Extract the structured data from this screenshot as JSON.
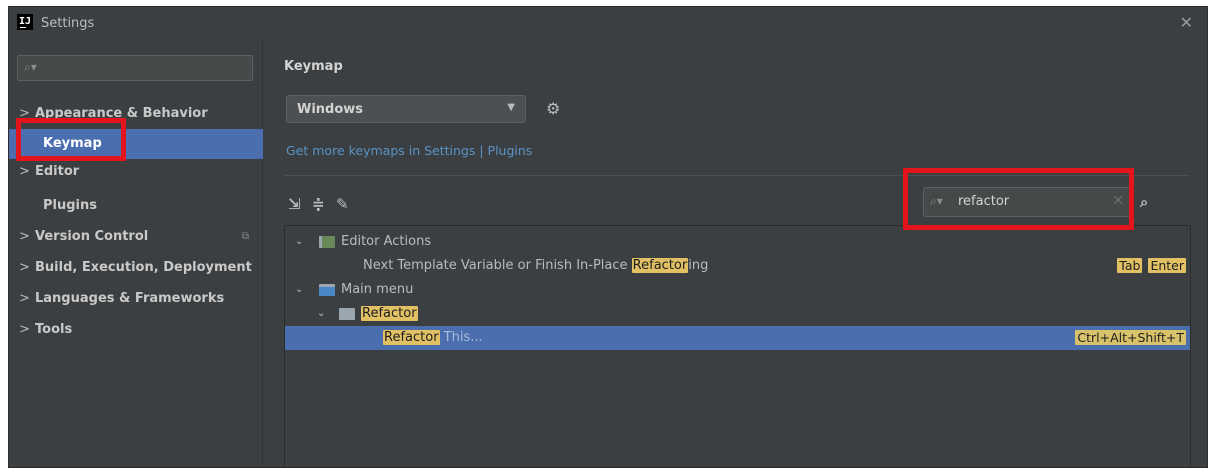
{
  "window": {
    "title": "Settings",
    "app_icon": "IJ",
    "close_glyph": "✕"
  },
  "sidebar": {
    "search": {
      "placeholder": "",
      "icon": "search-icon",
      "value": ""
    },
    "items": [
      {
        "label": "Appearance & Behavior",
        "chevron": ">"
      },
      {
        "label": "Keymap",
        "chevron": ""
      },
      {
        "label": "Editor",
        "chevron": ">"
      },
      {
        "label": "Plugins",
        "chevron": ""
      },
      {
        "label": "Version Control",
        "chevron": ">"
      },
      {
        "label": "Build, Execution, Deployment",
        "chevron": ">"
      },
      {
        "label": "Languages & Frameworks",
        "chevron": ">"
      },
      {
        "label": "Tools",
        "chevron": ">"
      }
    ]
  },
  "main": {
    "title": "Keymap",
    "keymap_select": {
      "value": "Windows",
      "arrow": "▼"
    },
    "gear_glyph": "⚙",
    "plugins_link": "Get more keymaps in Settings | Plugins",
    "toolbar": {
      "expand_glyph": "⇲",
      "collapse_glyph": "≑",
      "edit_glyph": "✎"
    },
    "filter": {
      "value": "refactor",
      "icon": "search-icon",
      "clear": "✕"
    },
    "find_shortcut_glyph": "⌕"
  },
  "tree": {
    "rows": [
      {
        "chevron": "⌄",
        "label": "Editor Actions"
      },
      {
        "pre": "Next Template Variable or Finish In-Place ",
        "match": "Refactor",
        "post": "ing",
        "keys": [
          "Tab",
          "Enter"
        ]
      },
      {
        "chevron": "⌄",
        "label": "Main menu"
      },
      {
        "chevron": "⌄",
        "match": "Refactor"
      },
      {
        "match": "Refactor",
        "post": " This...",
        "keys": [
          "Ctrl+Alt+Shift+T"
        ]
      }
    ]
  },
  "colors": {
    "background": "#3c3f41",
    "selection": "#4b6eaf",
    "highlight": "#e2c064",
    "link": "#5993c6",
    "annotation_red": "#e3141b"
  }
}
